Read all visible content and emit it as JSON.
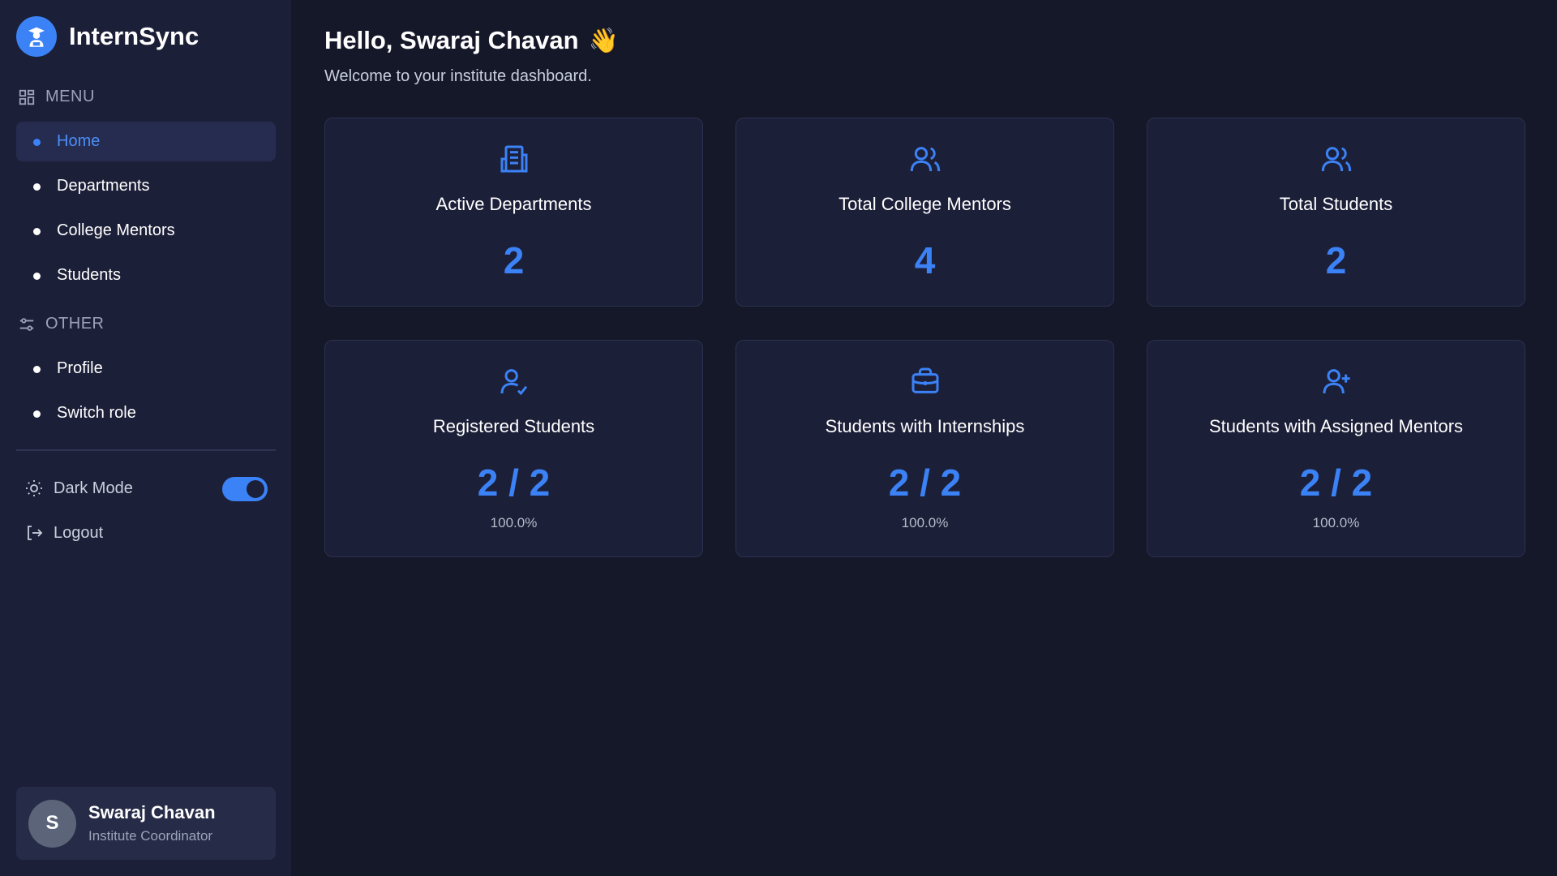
{
  "brand": {
    "name": "InternSync",
    "logo_icon": "graduate-icon"
  },
  "sidebar": {
    "menu_label": "MENU",
    "menu_items": [
      {
        "label": "Home",
        "active": true
      },
      {
        "label": "Departments",
        "active": false
      },
      {
        "label": "College Mentors",
        "active": false
      },
      {
        "label": "Students",
        "active": false
      }
    ],
    "other_label": "OTHER",
    "other_items": [
      {
        "label": "Profile"
      },
      {
        "label": "Switch role"
      }
    ],
    "dark_mode_label": "Dark Mode",
    "dark_mode_on": true,
    "logout_label": "Logout"
  },
  "user": {
    "initial": "S",
    "name": "Swaraj Chavan",
    "role": "Institute Coordinator"
  },
  "header": {
    "greeting": "Hello, Swaraj Chavan",
    "wave_emoji": "👋",
    "subtitle": "Welcome to your institute dashboard."
  },
  "cards": [
    {
      "icon": "building-icon",
      "title": "Active Departments",
      "value": "2"
    },
    {
      "icon": "users-icon",
      "title": "Total College Mentors",
      "value": "4"
    },
    {
      "icon": "users-icon",
      "title": "Total Students",
      "value": "2"
    },
    {
      "icon": "user-check-icon",
      "title": "Registered Students",
      "value": "2 / 2",
      "percent": "100.0%"
    },
    {
      "icon": "briefcase-icon",
      "title": "Students with Internships",
      "value": "2 / 2",
      "percent": "100.0%"
    },
    {
      "icon": "user-plus-icon",
      "title": "Students with Assigned Mentors",
      "value": "2 / 2",
      "percent": "100.0%"
    }
  ],
  "colors": {
    "accent": "#3b82f6",
    "sidebar_bg": "#1c1f38",
    "main_bg": "#151829"
  }
}
